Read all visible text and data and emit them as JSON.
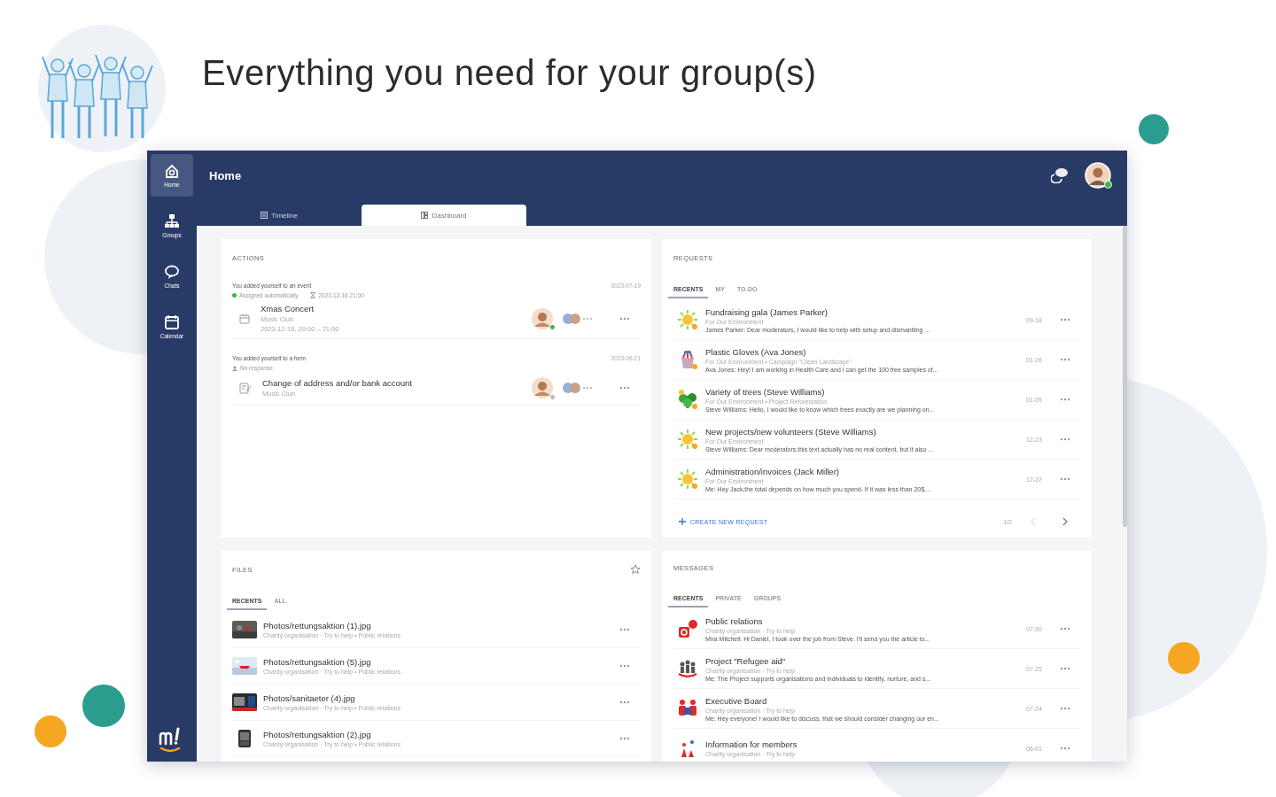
{
  "headline": "Everything you need for your group(s)",
  "app": {
    "nav": [
      {
        "label": "Home",
        "selected": true
      },
      {
        "label": "Groups",
        "selected": false
      },
      {
        "label": "Chats",
        "selected": false
      },
      {
        "label": "Calendar",
        "selected": false
      }
    ],
    "title": "Home",
    "user": {
      "online": true
    },
    "tabs": [
      {
        "label": "Timeline",
        "selected": false
      },
      {
        "label": "Dashboard",
        "selected": true
      }
    ],
    "actions": {
      "title": "ACTIONS",
      "items": [
        {
          "headline": "You added yourself to an event",
          "date": "2023-07-19",
          "meta": [
            {
              "kind": "status",
              "text": "Assigned automatically"
            },
            {
              "kind": "time",
              "text": "2023-12-16 21:00"
            }
          ],
          "kind": "event",
          "title": "Xmas Concert",
          "lines": [
            "Music Club",
            "2023-12-16, 20:00 – 21:00"
          ],
          "online": true
        },
        {
          "headline": "You added yourself to a form",
          "date": "2023-06-21",
          "meta": [
            {
              "kind": "person",
              "text": "No response"
            }
          ],
          "kind": "form",
          "title": "Change of address and/or bank account",
          "lines": [
            "Music Club"
          ],
          "online": false
        }
      ]
    },
    "requests": {
      "title": "REQUESTS",
      "tabs": [
        {
          "label": "RECENTS",
          "selected": true
        },
        {
          "label": "MY",
          "selected": false
        },
        {
          "label": "TO-DO",
          "selected": false
        }
      ],
      "rows": [
        {
          "title": "Fundraising gala (James Parker)",
          "context": "For Our Environment",
          "preview": "James Parker: Dear moderators, I would like to help with setup and dismantling ...",
          "date": "09-18"
        },
        {
          "title": "Plastic Gloves (Ava Jones)",
          "context": "For Our Environment • Campaign \"Clean Landscape\"",
          "preview": "Ava Jones: Hey! I am working in Health Care and I can get the 100 free samples of...",
          "date": "01-26"
        },
        {
          "title": "Variety of trees (Steve Williams)",
          "context": "For Our Environment • Project Reforestation",
          "preview": "Steve Williams: Hello, I would like to know which trees exactly are we planning on...",
          "date": "01-05"
        },
        {
          "title": "New projects/new volunteers (Steve Williams)",
          "context": "For Our Environment",
          "preview": "Steve Williams: Dear moderators,this text actually has no real content, but it also ...",
          "date": "12-23"
        },
        {
          "title": "Administration/invoices (Jack Miller)",
          "context": "For Our Environment",
          "preview": "Me: Hey Jack,the total depends on how much you spend. If it was less than 20$,...",
          "date": "12-22"
        }
      ],
      "create": "CREATE NEW REQUEST",
      "page": "1/2",
      "prev": {
        "disabled": true
      },
      "next": {
        "disabled": false
      }
    },
    "files": {
      "title": "FILES",
      "tabs": [
        {
          "label": "RECENTS",
          "selected": true
        },
        {
          "label": "ALL",
          "selected": false
        }
      ],
      "rows": [
        {
          "name": "Photos/rettungsaktion (1).jpg",
          "path": "Charity organisation · Try to help • Public relations"
        },
        {
          "name": "Photos/rettungsaktion (5).jpg",
          "path": "Charity organisation · Try to help • Public relations"
        },
        {
          "name": "Photos/sanitaeter (4).jpg",
          "path": "Charity organisation · Try to help • Public relations"
        },
        {
          "name": "Photos/rettungsaktion (2).jpg",
          "path": "Charity organisation · Try to help • Public relations"
        }
      ]
    },
    "messages": {
      "title": "MESSAGES",
      "tabs": [
        {
          "label": "RECENTS",
          "selected": true
        },
        {
          "label": "PRIVATE",
          "selected": false
        },
        {
          "label": "GROUPS",
          "selected": false
        }
      ],
      "rows": [
        {
          "title": "Public relations",
          "context": "Charity organisation · Try to help",
          "preview": "Mira Mitchell: Hi Daniel, I took over the job from Steve. I'll send you the article to...",
          "date": "07-30"
        },
        {
          "title": "Project \"Refugee aid\"",
          "context": "Charity organisation · Try to help",
          "preview": "Me: The Project supports organisations and individuals to identify, nurture, and s...",
          "date": "07-25"
        },
        {
          "title": "Executive Board",
          "context": "Charity organisation · Try to help",
          "preview": "Me: Hey everyone! I would like to discuss, that we should consider changing our en...",
          "date": "07-24"
        },
        {
          "title": "Information for members",
          "context": "Charity organisation · Try to help",
          "date": "06-01"
        }
      ]
    }
  }
}
